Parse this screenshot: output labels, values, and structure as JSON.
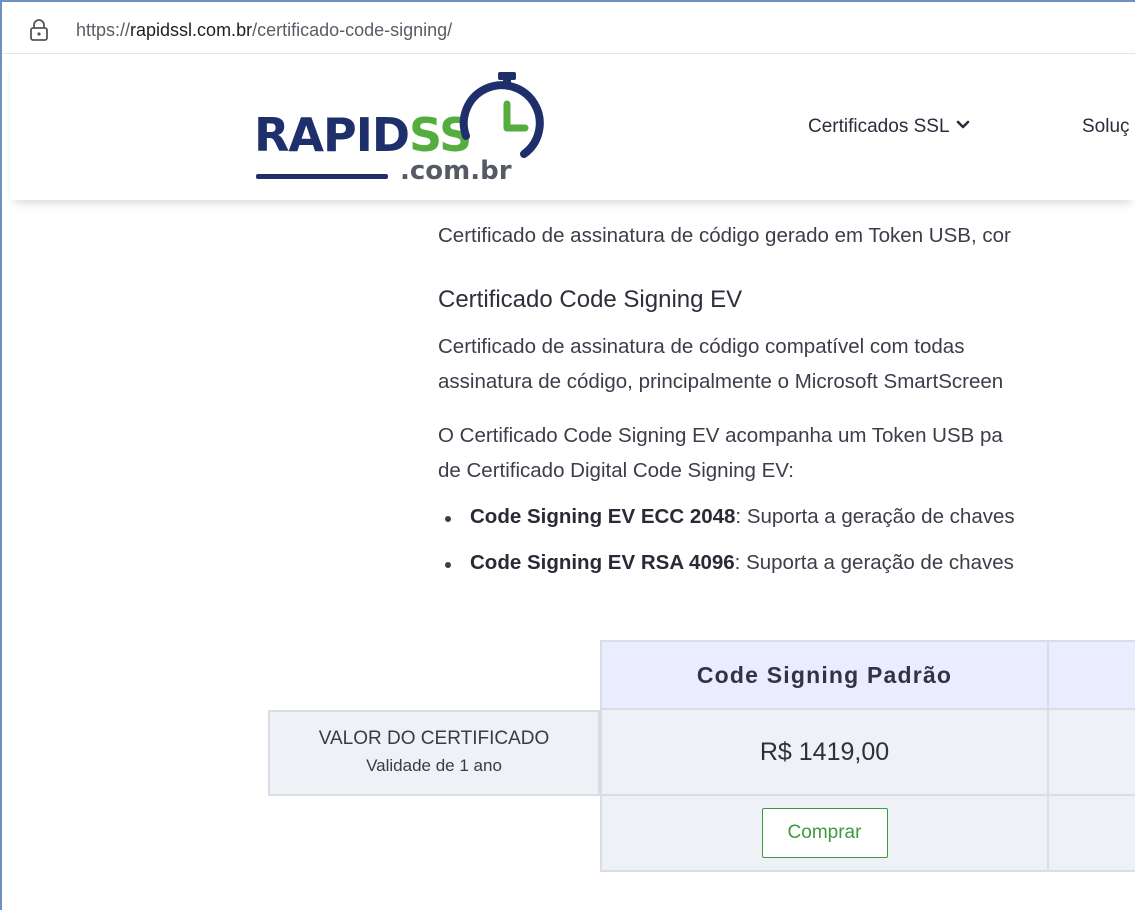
{
  "browser": {
    "url_scheme": "https://",
    "url_host": "rapidssl.com.br",
    "url_path": "/certificado-code-signing/"
  },
  "header": {
    "logo_text_primary": "RAPID",
    "logo_text_accent": "SS",
    "logo_tld": ".com.br",
    "nav_items": [
      "Certificados SSL",
      "Soluç"
    ],
    "colors": {
      "brand_navy": "#1f2f6b",
      "brand_green": "#53ae3e"
    }
  },
  "content": {
    "token_desc": "Certificado de assinatura de código gerado em Token USB, cor",
    "ev_heading": "Certificado Code Signing EV",
    "ev_desc_line1": "Certificado  de  assinatura  de  código  compatível  com  todas",
    "ev_desc_line2": "assinatura de código, principalmente o Microsoft SmartScreen",
    "ev_token_line1": "O Certificado Code Signing EV acompanha um Token USB pa",
    "ev_token_line2": "de Certificado Digital Code Signing EV:",
    "bullets": [
      {
        "title": "Code Signing EV ECC 2048",
        "text": ": Suporta a geração de chaves"
      },
      {
        "title": "Code Signing EV RSA 4096",
        "text": ": Suporta a geração de chaves"
      }
    ]
  },
  "table": {
    "product_header": "Code Signing Padrão",
    "row_label_line1": "VALOR DO CERTIFICADO",
    "row_label_line2": "Validade de 1 ano",
    "price": "R$ 1419,00",
    "buy_label": "Comprar",
    "colors": {
      "header_bg": "#e9edff",
      "cell_bg": "#eef1f6",
      "buy_green": "#3f9a3f"
    }
  },
  "icons": [
    "lock-icon",
    "chevron-down-icon",
    "clock-logo-icon"
  ]
}
